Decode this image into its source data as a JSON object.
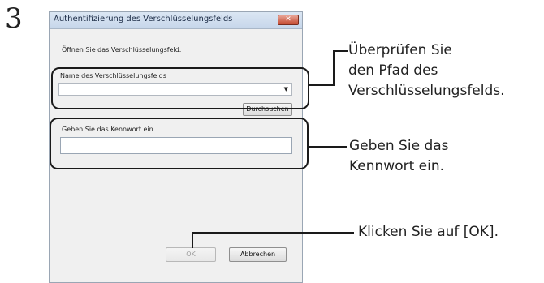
{
  "step": {
    "number": "3"
  },
  "dialog": {
    "title": "Authentifizierung des Verschlüsselungsfelds",
    "close_glyph": "✕",
    "instruction": "Öffnen Sie das Verschlüsselungsfeld.",
    "name_label": "Name des Verschlüsselungsfelds",
    "name_value": "",
    "dropdown_glyph": "▼",
    "browse_button": "Durchsuchen",
    "password_label": "Geben Sie das Kennwort ein.",
    "password_value": "",
    "ok_button": "OK",
    "cancel_button": "Abbrechen"
  },
  "callouts": {
    "path_line1": "Überprüfen Sie",
    "path_line2": "den Pfad des",
    "path_line3": "Verschlüsselungsfelds.",
    "password_line1": "Geben Sie das",
    "password_line2": "Kennwort ein.",
    "ok_text": "Klicken Sie auf [OK]."
  }
}
